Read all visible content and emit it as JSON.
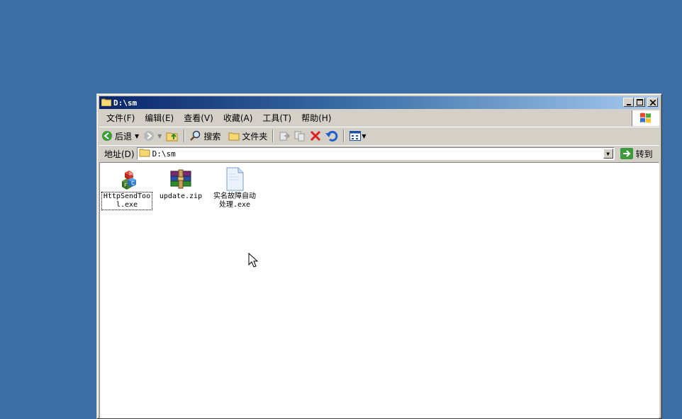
{
  "window": {
    "title": "D:\\sm"
  },
  "menu": [
    "文件(F)",
    "编辑(E)",
    "查看(V)",
    "收藏(A)",
    "工具(T)",
    "帮助(H)"
  ],
  "toolbar": {
    "back_label": "后退",
    "search_label": "搜索",
    "folders_label": "文件夹"
  },
  "address": {
    "label": "地址(D)",
    "value": "D:\\sm",
    "go_label": "转到"
  },
  "files": [
    {
      "name": "HttpSendTool.exe",
      "icon": "app-mfc-icon"
    },
    {
      "name": "update.zip",
      "icon": "winrar-archive-icon"
    },
    {
      "name": "实名故障自动处理.exe",
      "icon": "document-icon"
    }
  ],
  "colors": {
    "desktop": "#3a6ea5",
    "title_start": "#0a246a",
    "title_end": "#a6caf0",
    "chrome": "#d4d0c8"
  }
}
